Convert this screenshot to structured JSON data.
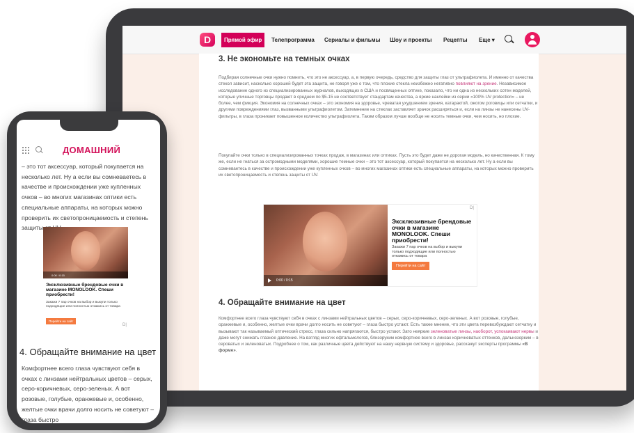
{
  "tablet": {
    "nav": {
      "logo": "D",
      "live": "Прямой эфир",
      "items": [
        "Телепрограмма",
        "Сериалы и фильмы",
        "Шоу и проекты",
        "Рецепты",
        "Еще ▾"
      ]
    },
    "heading1": "3. Не экономьте на темных очках",
    "para1": {
      "a": "Подбирая солнечные очки нужно помнить, что это не аксессуар, а, в первую очередь, средство для защиты глаз от ультрафиолета. И именно от качества стекол зависит, насколько хорошей будет эта защита, не говоря уже о том, что плохие стекла неизбежно негативно ",
      "link": "повлияют на зрение",
      "b": ". Независимое исследование одного из специализированных журналов, выходящих в США и посвященных оптике, показало, что ни одна из нескольких сотен моделей, которые уличные торговцы продают в среднем по $5-15 не соответствует стандартам качества, а яркие наклейки из серии «100% UV protection» – не более, чем фикция. Экономия на солнечных очках – это экономия на здоровье, чреватая ухудшением зрения, катарактой, ожогом роговицы или сетчатки, и другими повреждениями глаз, вызванными ультрафиолетом. Затемнение на стеклах заставляет зрачок расширяться и, если на линзы не нанесены UV-фильтры, в глаза проникает повышенное количество ультрафиолета. Таким образом лучше вообще не носить темные очки, чем носить, но плохие."
    },
    "para2": "Покупайте очки только в специализированных точках продаж, в магазинах или оптиках. Пусть это будет даже не дорогая модель, но качественная. К тому же, если не гнаться за остромодными моделями, хорошие темные очки – это тот аксессуар, который покупается на несколько лет. Ну а если вы сомневаетесь в качестве и происхождении уже купленных очков – во многих магазинах оптики есть специальные аппараты, на которых можно проверить их светопроницаемость и степень защиты от UV.",
    "ad": {
      "time": "0:00 / 0:15",
      "title": "Эксклюзивные брендовые очки в магазине MONOLOOK. Спеши приобрести!",
      "text": "Закажи 7 пар очков на выбор и выкупи только подходящие или полностью откажись от товара",
      "button": "Перейти на сайт",
      "choice": "D|"
    },
    "heading2": "4. Обращайте внимание на цвет",
    "para3": {
      "a": "Комфортнее всего глаза чувствуют себя в очках с линзами нейтральных цветов – серых, серо-коричневых, серо-зеленых. А вот розовые, голубые, оранжевые и, особенно, желтые очки врачи долго носить не советуют – глаза быстро устают. Есть также мнение, что эти цвета перевозбуждают сетчатку и вызывают так называемый оптический стресс, глаза сильно напрягаются, быстро устают. Зато неяркие ",
      "link1": "зеленоватые линзы, наоборот, успокаивают нервы",
      "b": " и даже могут снижать глазное давление. На взгляд многих офтальмологов, близоруким комфортнее всего в линзах коричневатых оттенков, дальнозорким – в сероватых и зеленоватых. Подробнее о том, как различные цвета действуют на нашу нервную систему и здоровье, расскажут эксперты программы ",
      "bold": "«В форме»",
      "c": "."
    }
  },
  "phone": {
    "brand": "ДОМАШНИЙ",
    "text_top": "– это тот аксессуар, который покупается на несколько лет. Ну а если вы сомневаетесь в качестве и происхождении уже купленных очков – во многих магазинах оптики есть специальные аппараты, на которых можно проверить их светопроницаемость и степень защиты от UV.",
    "ad": {
      "time": "0:00 / 0:15",
      "title": "Эксклюзивные брендовые очки в магазине MONOLOOK. Спеши приобрести!",
      "text": "Закажи 7 пар очков на выбор и выкупи только подходящие или полностью откажись от товара",
      "button": "Перейти на сайт",
      "choice": "D|"
    },
    "heading": "4. Обращайте внимание на цвет",
    "text_bottom": "Комфортнее всего глаза чувствуют себя в очках с линзами нейтральных цветов – серых, серо-коричневых, серо-зеленых. А вот розовые, голубые, оранжевые и, особенно, желтые очки врачи долго носить не советуют – глаза быстро"
  }
}
